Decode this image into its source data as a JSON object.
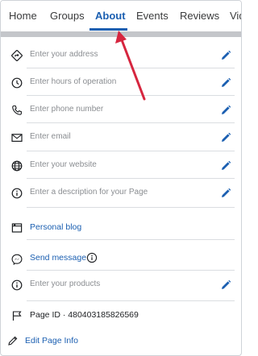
{
  "tabs": [
    {
      "label": "Home"
    },
    {
      "label": "Groups"
    },
    {
      "label": "About"
    },
    {
      "label": "Events"
    },
    {
      "label": "Reviews"
    },
    {
      "label": "Vid"
    }
  ],
  "rows": {
    "address": {
      "placeholder": "Enter your address",
      "icon": "location-diamond-icon"
    },
    "hours": {
      "placeholder": "Enter hours of operation",
      "icon": "clock-icon"
    },
    "phone": {
      "placeholder": "Enter phone number",
      "icon": "phone-icon"
    },
    "email": {
      "placeholder": "Enter email",
      "icon": "envelope-icon"
    },
    "website": {
      "placeholder": "Enter your website",
      "icon": "globe-icon"
    },
    "description": {
      "placeholder": "Enter a description for your Page",
      "icon": "info-icon"
    },
    "blog": {
      "label": "Personal blog",
      "icon": "page-icon"
    },
    "message": {
      "label": "Send message",
      "icon": "messenger-icon"
    },
    "products": {
      "placeholder": "Enter your products",
      "icon": "info-icon"
    },
    "page_id": {
      "label": "Page ID · 480403185826569",
      "icon": "flag-icon"
    },
    "edit_info": {
      "label": "Edit Page Info",
      "icon": "pencil-icon"
    }
  },
  "colors": {
    "accent": "#1b5fb1",
    "arrow": "#d6263f",
    "muted_text": "#8a8d91"
  }
}
